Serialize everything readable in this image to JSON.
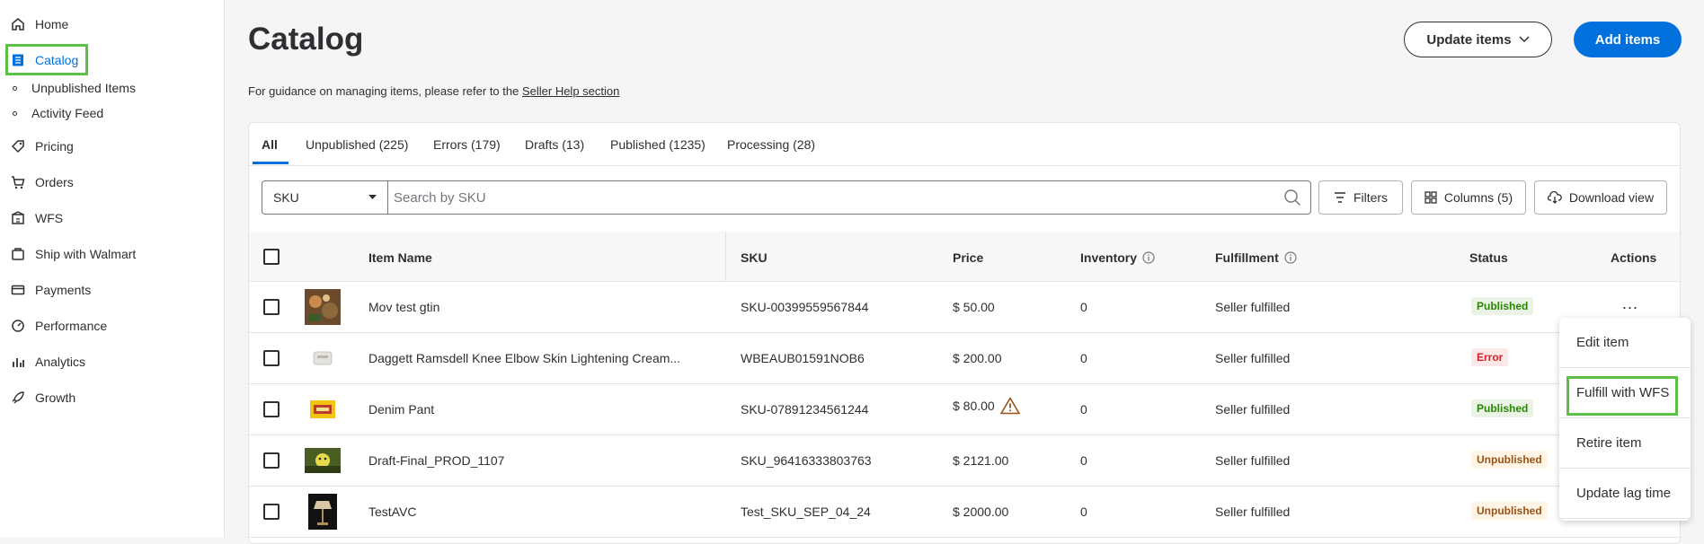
{
  "sidebar": {
    "items": [
      {
        "label": "Home",
        "icon": "home-icon"
      },
      {
        "label": "Catalog",
        "icon": "catalog-icon",
        "active": true
      },
      {
        "label": "Unpublished Items",
        "sub": true
      },
      {
        "label": "Activity Feed",
        "sub": true
      },
      {
        "label": "Pricing",
        "icon": "tag-icon"
      },
      {
        "label": "Orders",
        "icon": "cart-icon"
      },
      {
        "label": "WFS",
        "icon": "wfs-icon"
      },
      {
        "label": "Ship with Walmart",
        "icon": "ship-icon"
      },
      {
        "label": "Payments",
        "icon": "card-icon"
      },
      {
        "label": "Performance",
        "icon": "gauge-icon"
      },
      {
        "label": "Analytics",
        "icon": "chart-icon"
      },
      {
        "label": "Growth",
        "icon": "rocket-icon"
      }
    ]
  },
  "header": {
    "title": "Catalog",
    "guidance_prefix": "For guidance on managing items, please refer to the ",
    "guidance_link": "Seller Help section",
    "update_label": "Update items",
    "add_label": "Add items"
  },
  "tabs": [
    {
      "label": "All",
      "active": true
    },
    {
      "label": "Unpublished (225)"
    },
    {
      "label": "Errors (179)"
    },
    {
      "label": "Drafts (13)"
    },
    {
      "label": "Published (1235)"
    },
    {
      "label": "Processing (28)"
    }
  ],
  "search": {
    "field_value": "SKU",
    "placeholder": "Search by SKU"
  },
  "toolbar": {
    "filters_label": "Filters",
    "columns_label": "Columns (5)",
    "download_label": "Download view"
  },
  "table": {
    "headers": {
      "item_name": "Item Name",
      "sku": "SKU",
      "price": "Price",
      "inventory": "Inventory",
      "fulfillment": "Fulfillment",
      "status": "Status",
      "actions": "Actions"
    },
    "rows": [
      {
        "name": "Mov test gtin",
        "sku": "SKU-00399559567844",
        "price": "$ 50.00",
        "inventory": "0",
        "fulfillment": "Seller fulfilled",
        "status": "Published",
        "status_type": "published",
        "warning": false
      },
      {
        "name": "Daggett Ramsdell Knee Elbow Skin Lightening Cream...",
        "sku": "WBEAUB01591NOB6",
        "price": "$ 200.00",
        "inventory": "0",
        "fulfillment": "Seller fulfilled",
        "status": "Error",
        "status_type": "error",
        "warning": false
      },
      {
        "name": "Denim Pant",
        "sku": "SKU-07891234561244",
        "price": "$ 80.00",
        "inventory": "0",
        "fulfillment": "Seller fulfilled",
        "status": "Published",
        "status_type": "published",
        "warning": true
      },
      {
        "name": "Draft-Final_PROD_1107",
        "sku": "SKU_96416333803763",
        "price": "$ 2121.00",
        "inventory": "0",
        "fulfillment": "Seller fulfilled",
        "status": "Unpublished",
        "status_type": "unpublished",
        "warning": false
      },
      {
        "name": "TestAVC",
        "sku": "Test_SKU_SEP_04_24",
        "price": "$ 2000.00",
        "inventory": "0",
        "fulfillment": "Seller fulfilled",
        "status": "Unpublished",
        "status_type": "unpublished",
        "warning": false
      }
    ]
  },
  "actions_menu": {
    "trigger": "...",
    "items": [
      "Edit item",
      "Fulfill with WFS",
      "Retire item",
      "Update lag time"
    ]
  },
  "colors": {
    "accent": "#0071dc",
    "highlight": "#5cc043",
    "published": "#2a8703",
    "error": "#de1c24",
    "unpublished": "#995213"
  }
}
